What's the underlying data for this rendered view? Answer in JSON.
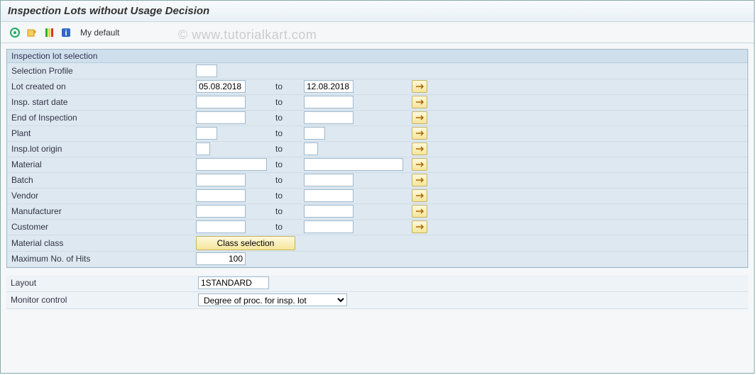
{
  "title": "Inspection Lots without Usage Decision",
  "watermark": "© www.tutorialkart.com",
  "toolbar": {
    "execute": "execute",
    "variant": "variant",
    "lights": "status-lights",
    "info": "info",
    "mydefault": "My default"
  },
  "group_title": "Inspection lot selection",
  "to_label": "to",
  "rows": {
    "selection_profile": {
      "label": "Selection Profile",
      "from": ""
    },
    "lot_created": {
      "label": "Lot created on",
      "from": "05.08.2018",
      "to": "12.08.2018"
    },
    "insp_start": {
      "label": "Insp. start date",
      "from": "",
      "to": ""
    },
    "end_insp": {
      "label": "End of Inspection",
      "from": "",
      "to": ""
    },
    "plant": {
      "label": "Plant",
      "from": "",
      "to": ""
    },
    "insp_origin": {
      "label": "Insp.lot origin",
      "from": "",
      "to": ""
    },
    "material": {
      "label": "Material",
      "from": "",
      "to": ""
    },
    "batch": {
      "label": "Batch",
      "from": "",
      "to": ""
    },
    "vendor": {
      "label": "Vendor",
      "from": "",
      "to": ""
    },
    "manufacturer": {
      "label": "Manufacturer",
      "from": "",
      "to": ""
    },
    "customer": {
      "label": "Customer",
      "from": "",
      "to": ""
    },
    "material_class": {
      "label": "Material class",
      "button": "Class selection"
    },
    "max_hits": {
      "label": "Maximum No. of Hits",
      "from": "100"
    }
  },
  "layout": {
    "label": "Layout",
    "value": "1STANDARD"
  },
  "monitor": {
    "label": "Monitor control",
    "value": "Degree of proc. for insp. lot"
  }
}
